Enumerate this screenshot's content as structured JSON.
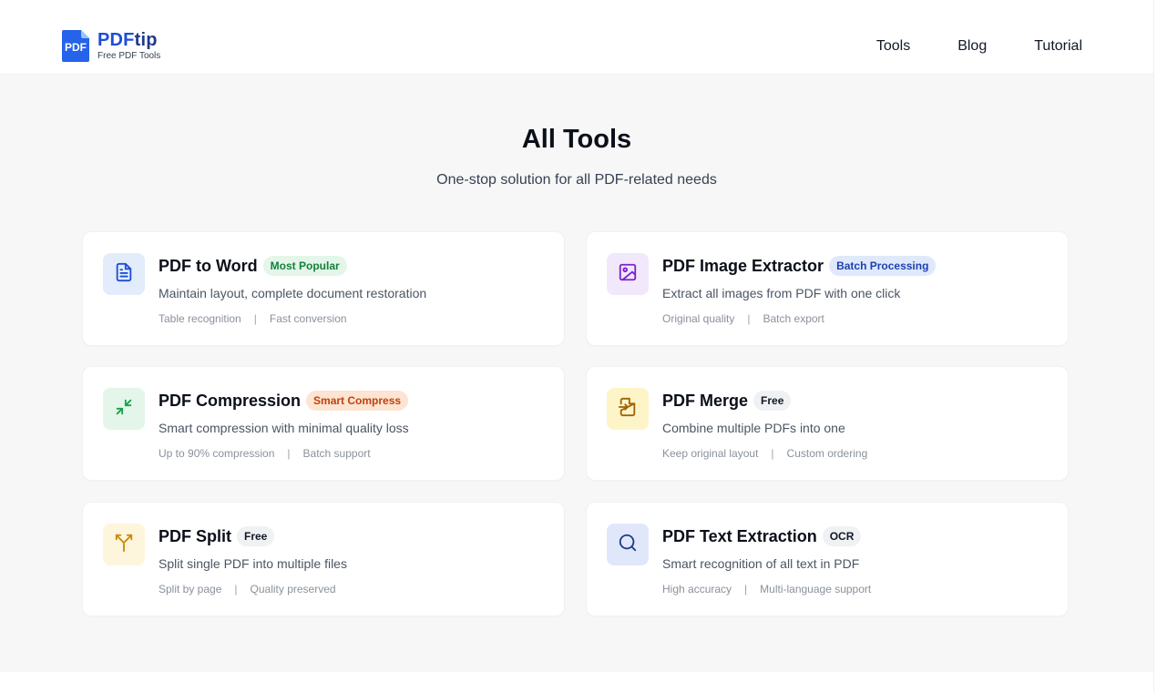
{
  "brand": {
    "name_main": "PDF",
    "name_accent": "tip",
    "tagline": "Free PDF Tools",
    "badge_text": "PDF"
  },
  "nav": {
    "items": [
      "Tools",
      "Blog",
      "Tutorial"
    ]
  },
  "page": {
    "title": "All Tools",
    "subtitle": "One-stop solution for all PDF-related needs"
  },
  "tools": [
    {
      "name": "PDF to Word",
      "badge": "Most Popular",
      "badge_bg": "#e3f6e9",
      "badge_color": "#15803d",
      "desc": "Maintain layout, complete document restoration",
      "features": [
        "Table recognition",
        "Fast conversion"
      ],
      "icon": "document-icon",
      "icon_bg": "#e3ecfb",
      "icon_color": "#1d4ed8"
    },
    {
      "name": "PDF Image Extractor",
      "badge": "Batch Processing",
      "badge_bg": "#dfe9fb",
      "badge_color": "#1e40af",
      "desc": "Extract all images from PDF with one click",
      "features": [
        "Original quality",
        "Batch export"
      ],
      "icon": "image-icon",
      "icon_bg": "#f1e8fb",
      "icon_color": "#7e22ce"
    },
    {
      "name": "PDF Compression",
      "badge": "Smart Compress",
      "badge_bg": "#fde4d3",
      "badge_color": "#c2410c",
      "desc": "Smart compression with minimal quality loss",
      "features": [
        "Up to 90% compression",
        "Batch support"
      ],
      "icon": "compress-icon",
      "icon_bg": "#e3f6e9",
      "icon_color": "#16a34a"
    },
    {
      "name": "PDF Merge",
      "badge": "Free",
      "badge_bg": "#f0f1f3",
      "badge_color": "#111827",
      "desc": "Combine multiple PDFs into one",
      "features": [
        "Keep original layout",
        "Custom ordering"
      ],
      "icon": "merge-file-icon",
      "icon_bg": "#fdf4c8",
      "icon_color": "#a16207"
    },
    {
      "name": "PDF Split",
      "badge": "Free",
      "badge_bg": "#f0f1f3",
      "badge_color": "#111827",
      "desc": "Split single PDF into multiple files",
      "features": [
        "Split by page",
        "Quality preserved"
      ],
      "icon": "split-icon",
      "icon_bg": "#fdf6dc",
      "icon_color": "#ca8a04"
    },
    {
      "name": "PDF Text Extraction",
      "badge": "OCR",
      "badge_bg": "#f0f1f3",
      "badge_color": "#111827",
      "desc": "Smart recognition of all text in PDF",
      "features": [
        "High accuracy",
        "Multi-language support"
      ],
      "icon": "search-icon",
      "icon_bg": "#e0e7fb",
      "icon_color": "#1e3a8a"
    }
  ]
}
